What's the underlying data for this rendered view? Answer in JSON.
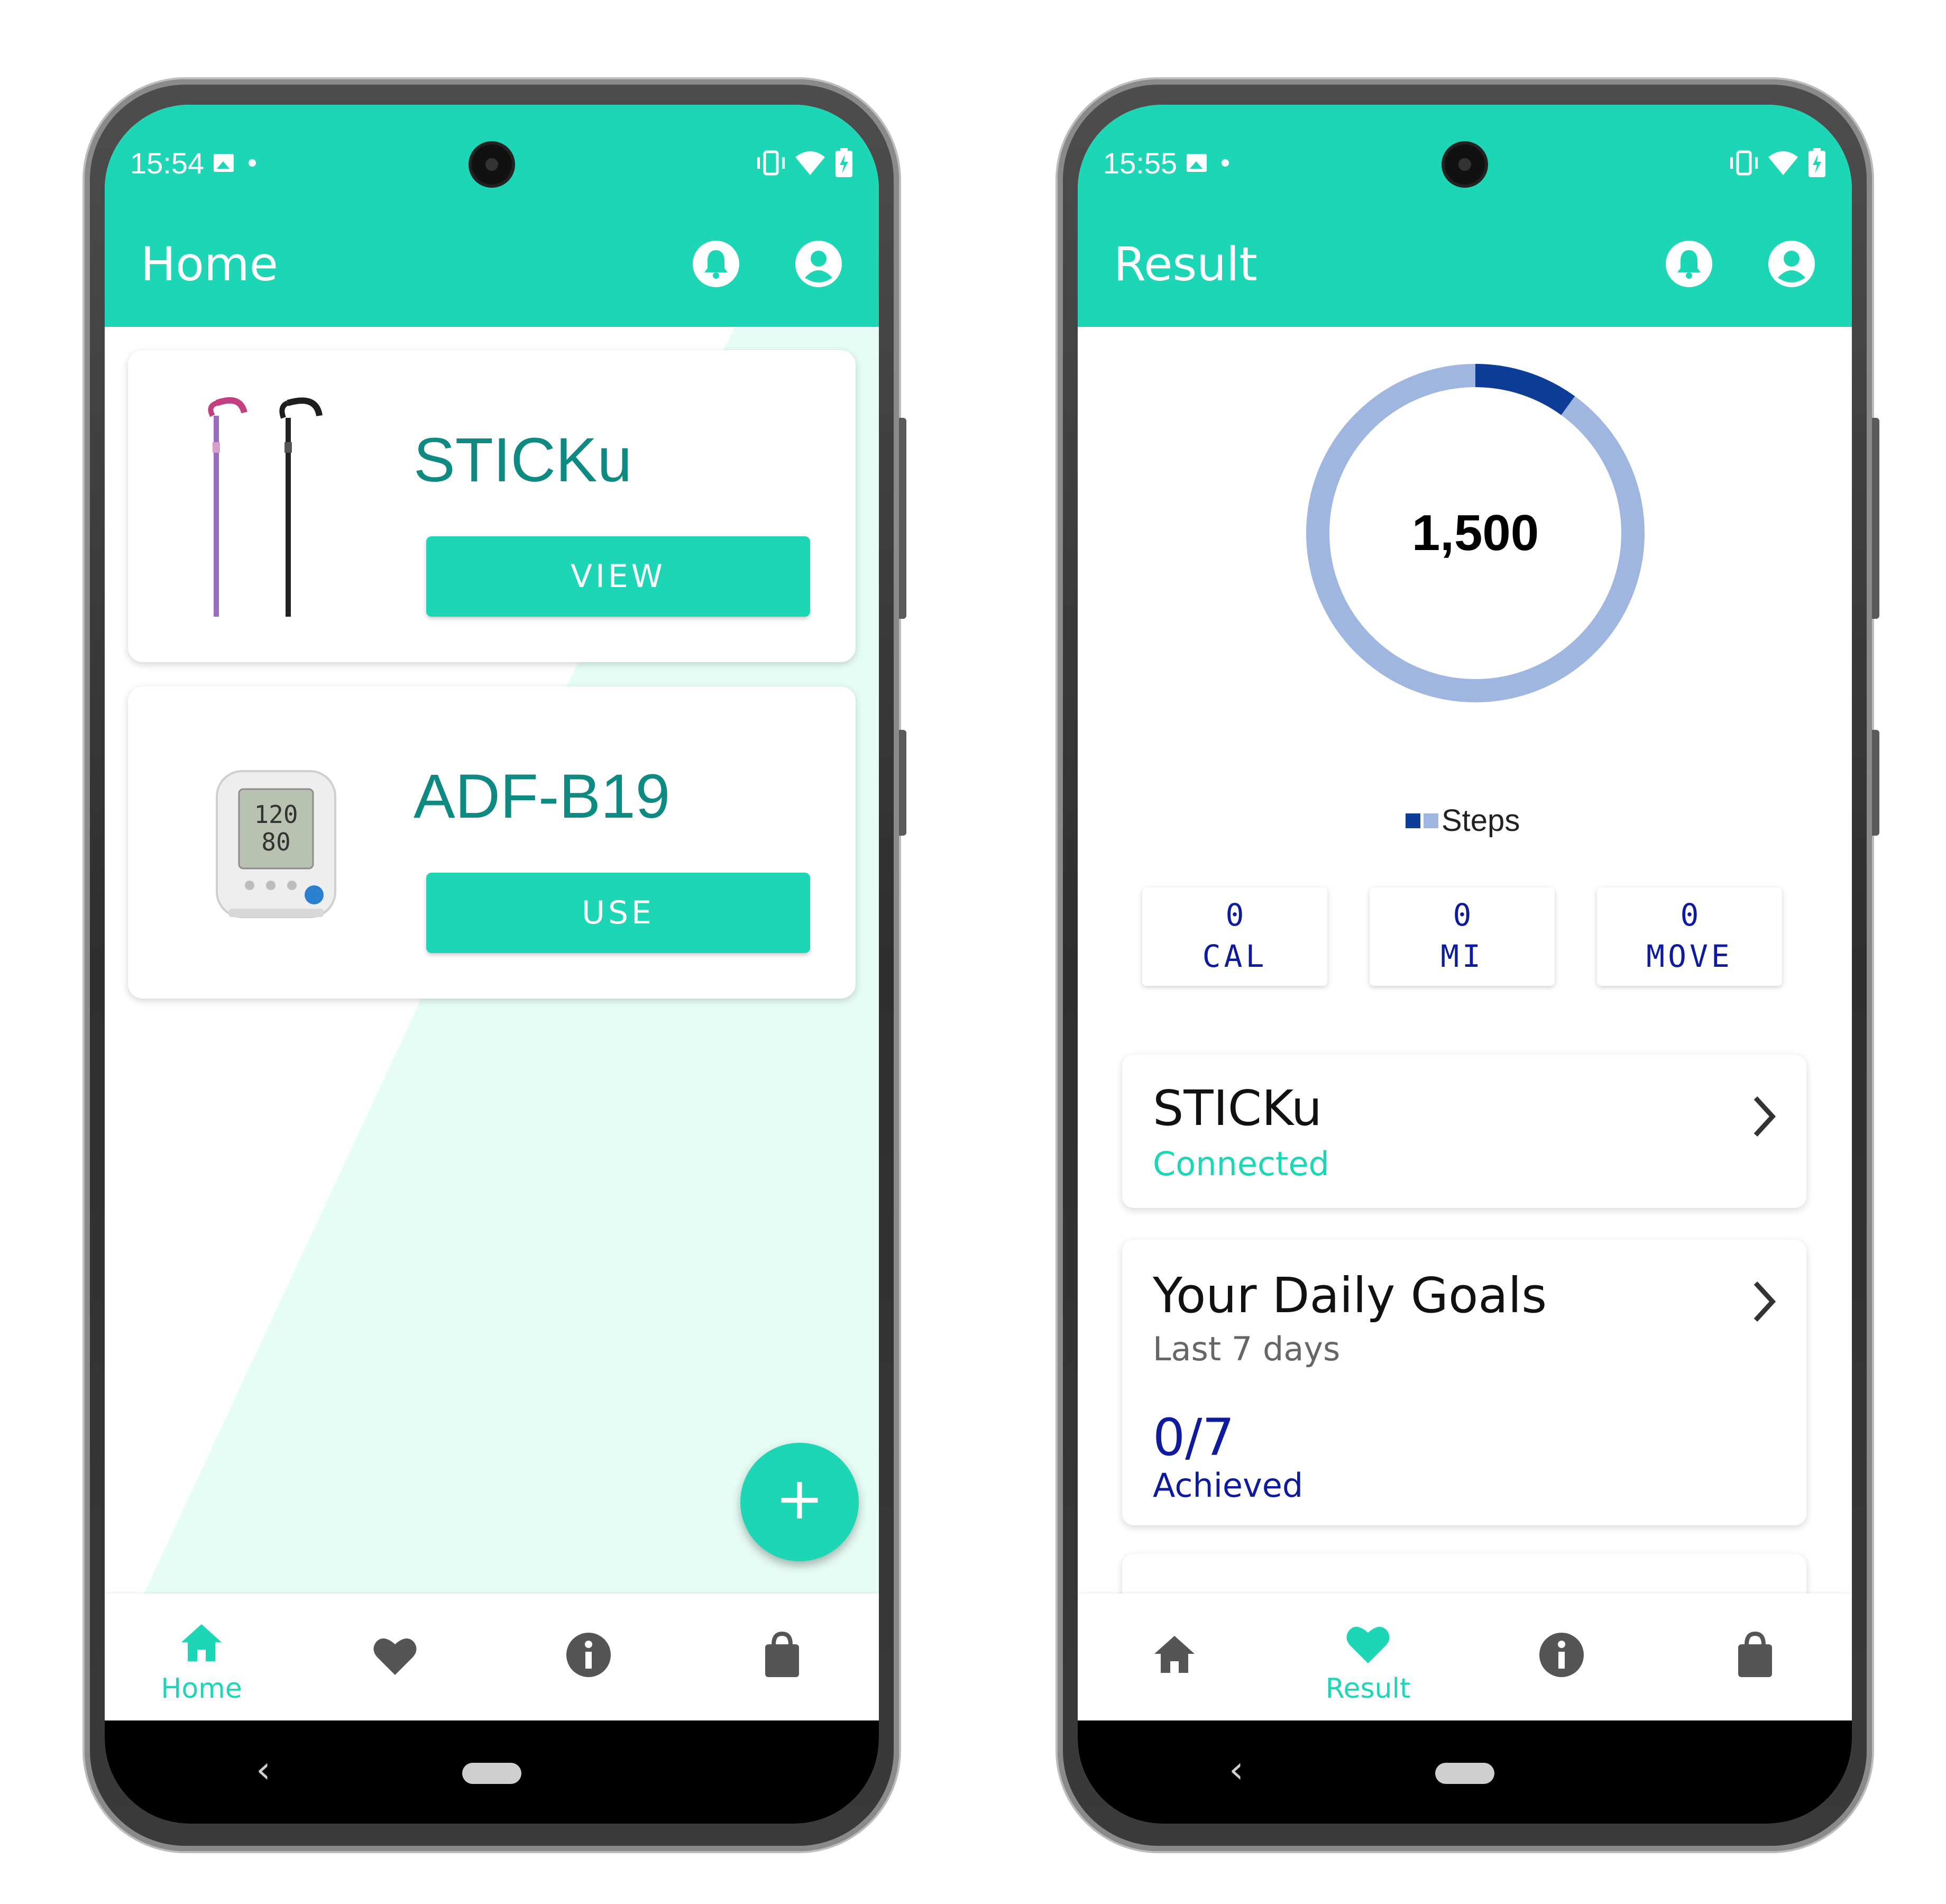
{
  "left_phone": {
    "status": {
      "time": "15:54"
    },
    "title": "Home",
    "devices": [
      {
        "name": "STICKu",
        "button": "VIEW",
        "image": "walking-canes"
      },
      {
        "name": "ADF-B19",
        "button": "USE",
        "image": "blood-pressure-monitor",
        "monitor_readings": [
          "120",
          "80"
        ]
      }
    ],
    "fab": "+",
    "nav": [
      {
        "label": "Home",
        "icon": "home-icon",
        "active": true
      },
      {
        "label": "",
        "icon": "heart-icon",
        "active": false
      },
      {
        "label": "",
        "icon": "info-icon",
        "active": false
      },
      {
        "label": "",
        "icon": "shopping-bag-icon",
        "active": false
      }
    ]
  },
  "right_phone": {
    "status": {
      "time": "15:55"
    },
    "title": "Result",
    "steps_value": "1,500",
    "progress_fraction": 0.1,
    "legend_label": "Steps",
    "stats": [
      {
        "value": "0",
        "unit": "CAL"
      },
      {
        "value": "0",
        "unit": "MI"
      },
      {
        "value": "0",
        "unit": "MOVE"
      }
    ],
    "device_card": {
      "title": "STICKu",
      "subtitle": "Connected"
    },
    "goals_card": {
      "title": "Your Daily Goals",
      "subtitle": "Last 7 days",
      "value": "0/7",
      "label": "Achieved"
    },
    "nav": [
      {
        "label": "",
        "icon": "home-icon",
        "active": false
      },
      {
        "label": "Result",
        "icon": "heart-icon",
        "active": true
      },
      {
        "label": "",
        "icon": "info-icon",
        "active": false
      },
      {
        "label": "",
        "icon": "shopping-bag-icon",
        "active": false
      }
    ]
  },
  "colors": {
    "accent": "#1dd6b5",
    "device_name": "#0e8a82",
    "ring_track": "#9fb6e0",
    "ring_progress": "#0d3d96",
    "stat_text": "#0d1b9c",
    "inactive_icon": "#555555"
  }
}
